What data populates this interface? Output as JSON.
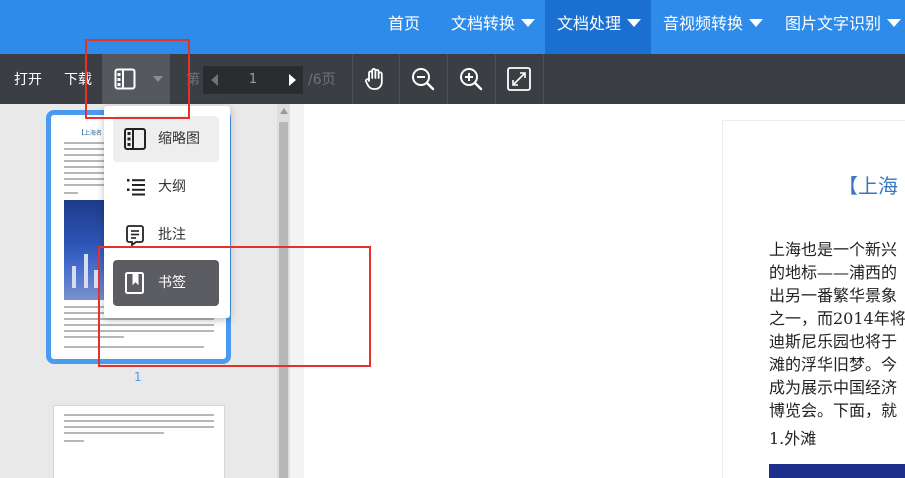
{
  "top_nav": {
    "items": [
      {
        "label": "首页",
        "has_caret": false
      },
      {
        "label": "文档转换",
        "has_caret": true
      },
      {
        "label": "文档处理",
        "has_caret": true,
        "active": true
      },
      {
        "label": "音视频转换",
        "has_caret": true
      },
      {
        "label": "图片文字识别",
        "has_caret": true
      }
    ]
  },
  "toolbar": {
    "open_label": "打开",
    "download_label": "下载",
    "page_prefix": "第",
    "current_page": "1",
    "page_total": "/6页",
    "tools": [
      "hand-icon",
      "zoom-out-icon",
      "zoom-in-icon",
      "fullscreen-icon"
    ]
  },
  "view_menu": {
    "items": [
      {
        "label": "缩略图",
        "icon": "thumbnail-icon",
        "state": "hover"
      },
      {
        "label": "大纲",
        "icon": "outline-icon",
        "state": "normal"
      },
      {
        "label": "批注",
        "icon": "annotation-icon",
        "state": "normal"
      },
      {
        "label": "书签",
        "icon": "bookmark-icon",
        "state": "active"
      }
    ]
  },
  "thumbnails": {
    "page1_title": "【上海名",
    "page1_label": "1"
  },
  "document": {
    "title": "【上海",
    "lines": [
      "上海也是一个新兴",
      "的地标——浦西的",
      "出另一番繁华景象",
      "之一，而2014年将",
      "迪斯尼乐园也将于",
      "滩的浮华旧梦。今",
      "成为展示中国经济",
      "博览会。下面，就"
    ],
    "section_heading": "1.外滩"
  },
  "colors": {
    "nav_bg": "#2f8be9",
    "nav_active": "#1a6fd0",
    "toolbar_bg": "#3b3e43",
    "highlight_box": "#e5312b",
    "thumb_border": "#4a9bf0"
  }
}
